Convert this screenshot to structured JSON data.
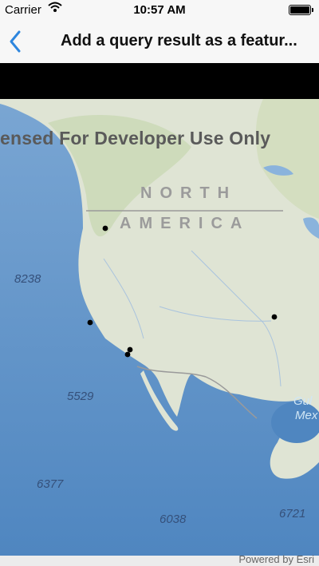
{
  "status_bar": {
    "carrier": "Carrier",
    "time": "10:57 AM",
    "battery_level_percent": 100
  },
  "nav": {
    "back_icon": "chevron-left-icon",
    "title": "Add a query result as a featur..."
  },
  "map": {
    "watermark": "ensed For Developer Use Only",
    "region_label_line1": "NORTH",
    "region_label_line2": "AMERICA",
    "depth_labels": [
      "8238",
      "5529",
      "6377",
      "6038",
      "6721"
    ],
    "gulf_label_line1": "Gul",
    "gulf_label_line2": "Mex",
    "attribution": "Powered by Esri",
    "colors": {
      "ocean": "#5a8fc6",
      "land": "#dfe4d4",
      "feature_point": "#000000",
      "accent": "#2e86de"
    }
  }
}
